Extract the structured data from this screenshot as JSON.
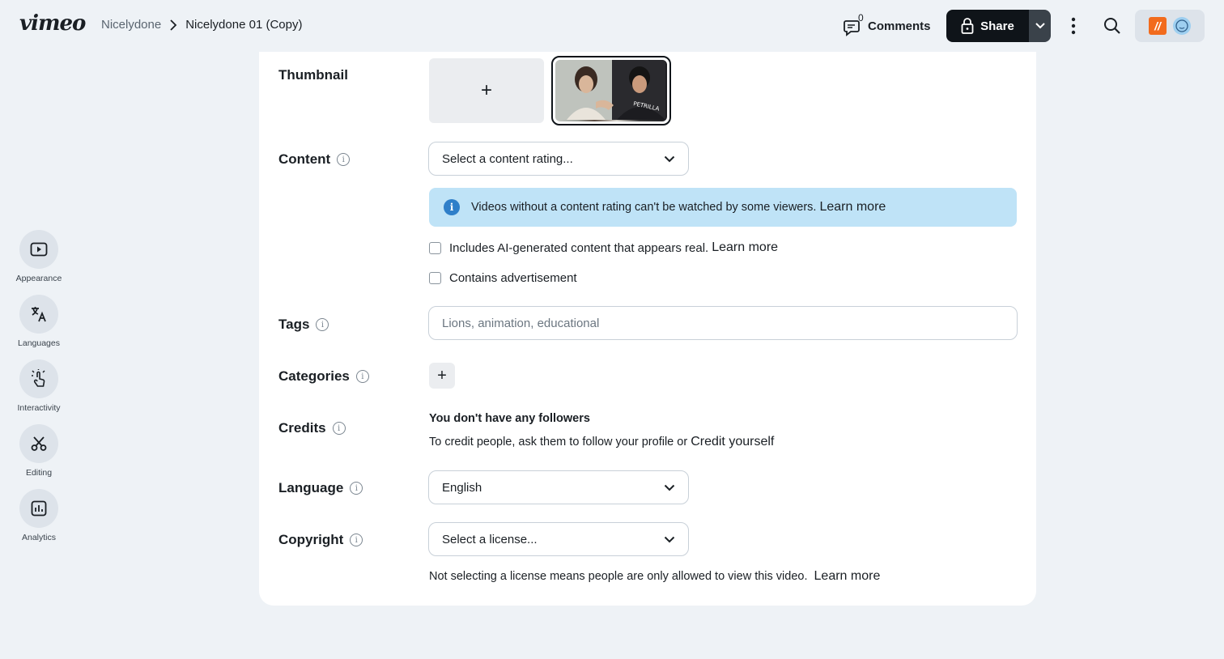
{
  "header": {
    "logo": "vimeo",
    "breadcrumb_parent": "Nicelydone",
    "breadcrumb_current": "Nicelydone 01 (Copy)",
    "comments_count": "0",
    "comments_label": "Comments",
    "share_label": "Share"
  },
  "rail": {
    "items": [
      {
        "label": "Appearance"
      },
      {
        "label": "Languages"
      },
      {
        "label": "Interactivity"
      },
      {
        "label": "Editing"
      },
      {
        "label": "Analytics"
      }
    ]
  },
  "form": {
    "thumbnail_label": "Thumbnail",
    "thumbnail_add": "+",
    "content_label": "Content",
    "content_select": "Select a content rating...",
    "banner_text": "Videos without a content rating can't be watched by some viewers.",
    "banner_link": "Learn more",
    "ai_checkbox_label": "Includes AI-generated content that appears real.",
    "ai_learn_more": "Learn more",
    "ad_checkbox_label": "Contains advertisement",
    "tags_label": "Tags",
    "tags_placeholder": "Lions, animation, educational",
    "categories_label": "Categories",
    "categories_add": "+",
    "credits_label": "Credits",
    "credits_title": "You don't have any followers",
    "credits_text": "To credit people, ask them to follow your profile or",
    "credits_link": "Credit yourself",
    "language_label": "Language",
    "language_value": "English",
    "copyright_label": "Copyright",
    "copyright_select": "Select a license...",
    "license_note": "Not selecting a license means people are only allowed to view this video.",
    "license_learn_more": "Learn more"
  },
  "colors": {
    "background": "#eef2f6",
    "share_button": "#0f1419",
    "info_banner": "#bfe3f7",
    "info_icon": "#2f7fc9",
    "team_logo": "#f26b1d"
  }
}
